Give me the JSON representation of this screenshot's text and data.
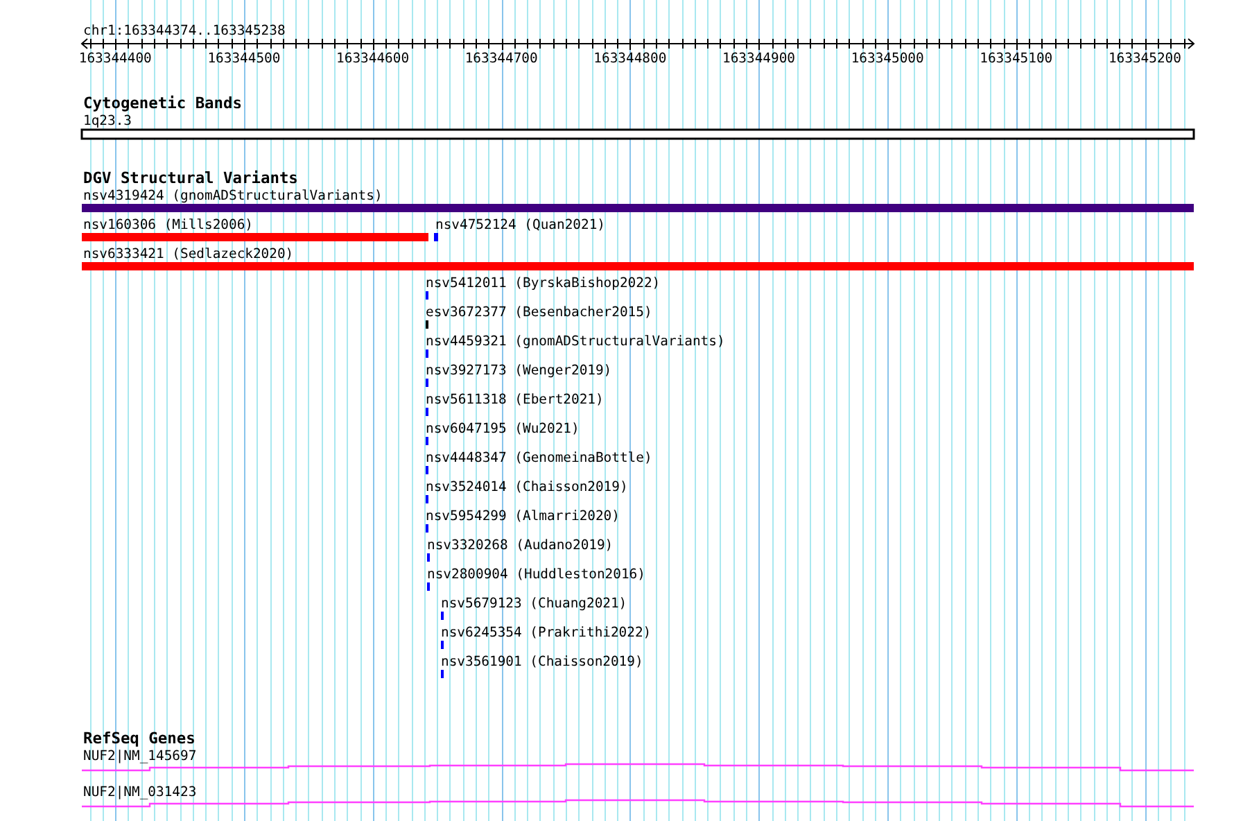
{
  "ruler": {
    "position": "chr1:163344374..163345238",
    "labels": [
      "163344400",
      "163344500",
      "163344600",
      "163344700",
      "163344800",
      "163344900",
      "163345000",
      "163345100",
      "163345200"
    ]
  },
  "tracks": [
    {
      "kind": "cytoband",
      "title": "Cytogenetic Bands",
      "features": [
        {
          "label": "1q23.3"
        }
      ]
    },
    {
      "kind": "variants",
      "title": "DGV Structural Variants",
      "features": [
        {
          "label": "nsv4319424 (gnomADStructuralVariants)",
          "color": "#400080"
        },
        {
          "label": "nsv160306 (Mills2006)",
          "color": "#ff0000"
        },
        {
          "label": "nsv4752124 (Quan2021)",
          "color": "#0000ff"
        },
        {
          "label": "nsv6333421 (Sedlazeck2020)",
          "color": "#ff0000"
        },
        {
          "label": "nsv5412011 (ByrskaBishop2022)",
          "color": "#0000ff"
        },
        {
          "label": "esv3672377 (Besenbacher2015)",
          "color": "#000000"
        },
        {
          "label": "nsv4459321 (gnomADStructuralVariants)",
          "color": "#0000ff"
        },
        {
          "label": "nsv3927173 (Wenger2019)",
          "color": "#0000ff"
        },
        {
          "label": "nsv5611318 (Ebert2021)",
          "color": "#0000ff"
        },
        {
          "label": "nsv6047195 (Wu2021)",
          "color": "#0000ff"
        },
        {
          "label": "nsv4448347 (GenomeinaBottle)",
          "color": "#0000ff"
        },
        {
          "label": "nsv3524014 (Chaisson2019)",
          "color": "#0000ff"
        },
        {
          "label": "nsv5954299 (Almarri2020)",
          "color": "#0000ff"
        },
        {
          "label": "nsv3320268 (Audano2019)",
          "color": "#0000ff"
        },
        {
          "label": "nsv2800904 (Huddleston2016)",
          "color": "#0000ff"
        },
        {
          "label": "nsv5679123 (Chuang2021)",
          "color": "#0000ff"
        },
        {
          "label": "nsv6245354 (Prakrithi2022)",
          "color": "#0000ff"
        },
        {
          "label": "nsv3561901 (Chaisson2019)",
          "color": "#0000ff"
        }
      ]
    },
    {
      "kind": "genes",
      "title": "RefSeq Genes",
      "features": [
        {
          "label": "NUF2|NM_145697"
        },
        {
          "label": "NUF2|NM_031423"
        }
      ]
    }
  ]
}
